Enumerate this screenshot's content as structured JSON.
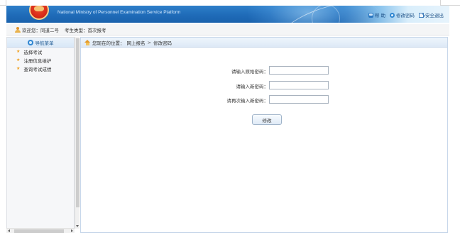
{
  "header": {
    "platform_title": "National Ministry of Personnel Examination Service Platform",
    "links": [
      {
        "label": "帮 助",
        "icon": "help-icon"
      },
      {
        "label": "修改密码",
        "icon": "key-circle-icon"
      },
      {
        "label": "安全退出",
        "icon": "exit-icon"
      }
    ]
  },
  "info_bar": {
    "welcome": "欢迎您：同道二号",
    "candidate_type": "考生类型：首次报考"
  },
  "sidebar": {
    "title": "导航菜单",
    "items": [
      {
        "label": "选择考试"
      },
      {
        "label": "注册信息维护"
      },
      {
        "label": "查询考试成绩"
      }
    ]
  },
  "main": {
    "breadcrumb": {
      "prefix": "您现在的位置：",
      "path": [
        "网上报名",
        "修改密码"
      ],
      "separator": ">"
    },
    "form": {
      "fields": [
        {
          "label": "请输入原始密码：",
          "value": ""
        },
        {
          "label": "请输入新密码：",
          "value": ""
        },
        {
          "label": "请再次输入新密码：",
          "value": ""
        }
      ],
      "submit_label": "修改"
    }
  },
  "colors": {
    "header_blue": "#1f6bb8",
    "accent_star": "#f0a020",
    "link_blue": "#1b4f86"
  }
}
